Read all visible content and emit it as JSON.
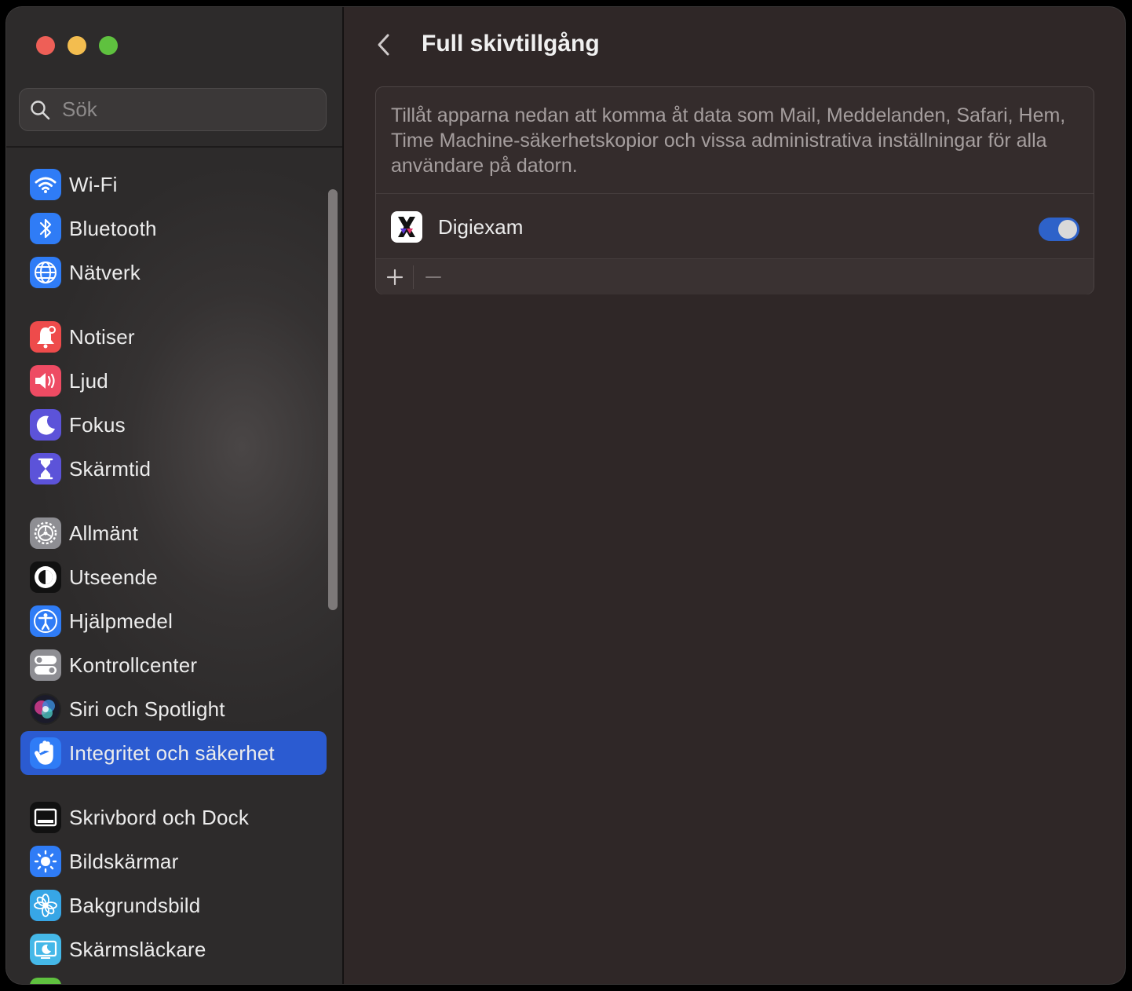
{
  "window": {
    "traffic_lights": [
      "close",
      "minimize",
      "zoom"
    ]
  },
  "sidebar": {
    "search_placeholder": "Sök",
    "items": [
      {
        "label": "Wi-Fi",
        "icon": "wifi-icon",
        "color": "#2f7cf6"
      },
      {
        "label": "Bluetooth",
        "icon": "bluetooth-icon",
        "color": "#2f7cf6"
      },
      {
        "label": "Nätverk",
        "icon": "globe-icon",
        "color": "#2f7cf6"
      },
      {
        "label": "Notiser",
        "icon": "bell-icon",
        "color": "#ee4b4b"
      },
      {
        "label": "Ljud",
        "icon": "speaker-icon",
        "color": "#ee4b63"
      },
      {
        "label": "Fokus",
        "icon": "moon-icon",
        "color": "#5c53d9"
      },
      {
        "label": "Skärmtid",
        "icon": "hourglass-icon",
        "color": "#5c53d9"
      },
      {
        "label": "Allmänt",
        "icon": "gear-icon",
        "color": "#8e8e93"
      },
      {
        "label": "Utseende",
        "icon": "appearance-icon",
        "color": "#111111"
      },
      {
        "label": "Hjälpmedel",
        "icon": "accessibility-icon",
        "color": "#2f7cf6"
      },
      {
        "label": "Kontrollcenter",
        "icon": "switches-icon",
        "color": "#8e8e93"
      },
      {
        "label": "Siri och Spotlight",
        "icon": "siri-icon",
        "color": "#222222"
      },
      {
        "label": "Integritet och säkerhet",
        "icon": "hand-icon",
        "color": "#2f7cf6",
        "selected": true
      },
      {
        "label": "Skrivbord och Dock",
        "icon": "dock-icon",
        "color": "#111111"
      },
      {
        "label": "Bildskärmar",
        "icon": "sun-icon",
        "color": "#2f7cf6"
      },
      {
        "label": "Bakgrundsbild",
        "icon": "flower-icon",
        "color": "#37a6e6"
      },
      {
        "label": "Skärmsläckare",
        "icon": "screensaver-icon",
        "color": "#45b8e8"
      }
    ]
  },
  "main": {
    "title": "Full skivtillgång",
    "description": "Tillåt apparna nedan att komma åt data som Mail, Meddelanden, Safari, Hem, Time Machine-säkerhetskopior och vissa administrativa inställningar för alla användare på datorn.",
    "apps": [
      {
        "name": "Digiexam",
        "enabled": true
      }
    ],
    "accent_color": "#2e62c9"
  }
}
